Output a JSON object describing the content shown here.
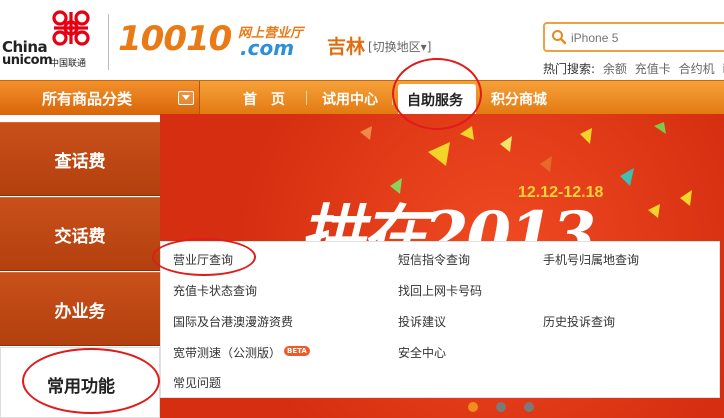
{
  "header": {
    "logo_en_line1": "China",
    "logo_en_line2": "unicom",
    "logo_cn": "中国联通",
    "brand_number": "10010",
    "brand_cn": "网上营业厅",
    "brand_com": ".com",
    "region": "吉林",
    "region_switch": "[切换地区▾]",
    "search_placeholder": "iPhone 5",
    "hot_search_label": "热门搜索:",
    "hot_search_items": [
      "余额",
      "充值卡",
      "合约机",
      "iF"
    ]
  },
  "nav": {
    "category_label": "所有商品分类",
    "items": [
      "首　页",
      "试用中心",
      "自助服务",
      "积分商城"
    ]
  },
  "sidebar": {
    "items": [
      "查话费",
      "交话费",
      "办业务",
      "常用功能"
    ]
  },
  "banner": {
    "date": "12.12-12.18",
    "title": "拱在2013"
  },
  "panel": {
    "links": [
      "营业厅查询",
      "短信指令查询",
      "手机号归属地查询",
      "充值卡状态查询",
      "找回上网卡号码",
      "国际及台港澳漫游资费",
      "投诉建议",
      "历史投诉查询",
      "宽带测速（公测版）",
      "安全中心",
      "常见问题"
    ],
    "beta_label": "BETA"
  },
  "colors": {
    "orange": "#ea7a16",
    "nav_gradient_top": "#f6a13a",
    "nav_gradient_bottom": "#e37a12",
    "sidebar_red": "#b3400f",
    "banner_red": "#d52e10",
    "annotation_red": "#e21a1a"
  }
}
